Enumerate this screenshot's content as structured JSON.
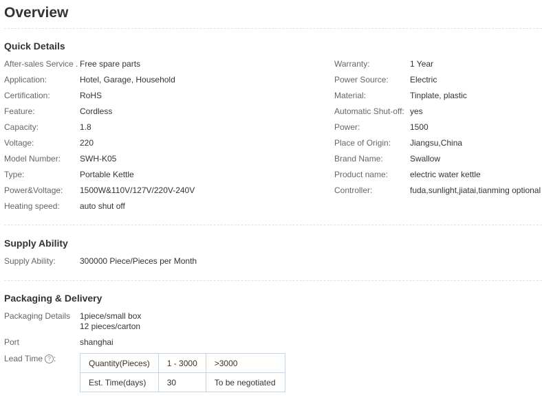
{
  "page_title": "Overview",
  "quick_details": {
    "heading": "Quick Details",
    "left": [
      {
        "label": "After-sales Service ...",
        "value": "Free spare parts"
      },
      {
        "label": "Application:",
        "value": "Hotel, Garage, Household"
      },
      {
        "label": "Certification:",
        "value": "RoHS"
      },
      {
        "label": "Feature:",
        "value": "Cordless"
      },
      {
        "label": "Capacity:",
        "value": "1.8"
      },
      {
        "label": "Voltage:",
        "value": "220"
      },
      {
        "label": "Model Number:",
        "value": "SWH-K05"
      },
      {
        "label": "Type:",
        "value": "Portable Kettle"
      },
      {
        "label": "Power&Voltage:",
        "value": "1500W&110V/127V/220V-240V"
      },
      {
        "label": "Heating speed:",
        "value": "auto shut off"
      }
    ],
    "right": [
      {
        "label": "Warranty:",
        "value": "1 Year"
      },
      {
        "label": "Power Source:",
        "value": "Electric"
      },
      {
        "label": "Material:",
        "value": "Tinplate, plastic"
      },
      {
        "label": "Automatic Shut-off:",
        "value": "yes"
      },
      {
        "label": "Power:",
        "value": "1500"
      },
      {
        "label": "Place of Origin:",
        "value": "Jiangsu,China"
      },
      {
        "label": "Brand Name:",
        "value": "Swallow"
      },
      {
        "label": "Product name:",
        "value": "electric water kettle"
      },
      {
        "label": "Controller:",
        "value": "fuda,sunlight,jiatai,tianming optional"
      }
    ]
  },
  "supply_ability": {
    "heading": "Supply Ability",
    "label": "Supply Ability:",
    "value": "300000 Piece/Pieces per Month"
  },
  "packaging": {
    "heading": "Packaging & Delivery",
    "details_label": "Packaging Details",
    "details_lines": [
      "1piece/small box",
      "12 pieces/carton"
    ],
    "port_label": "Port",
    "port_value": "shanghai",
    "lead_time_label": "Lead Time",
    "lead_time_icon": "question-circle-icon",
    "lead_table": {
      "rows": [
        [
          "Quantity(Pieces)",
          "1 - 3000",
          ">3000"
        ],
        [
          "Est. Time(days)",
          "30",
          "To be negotiated"
        ]
      ]
    }
  }
}
